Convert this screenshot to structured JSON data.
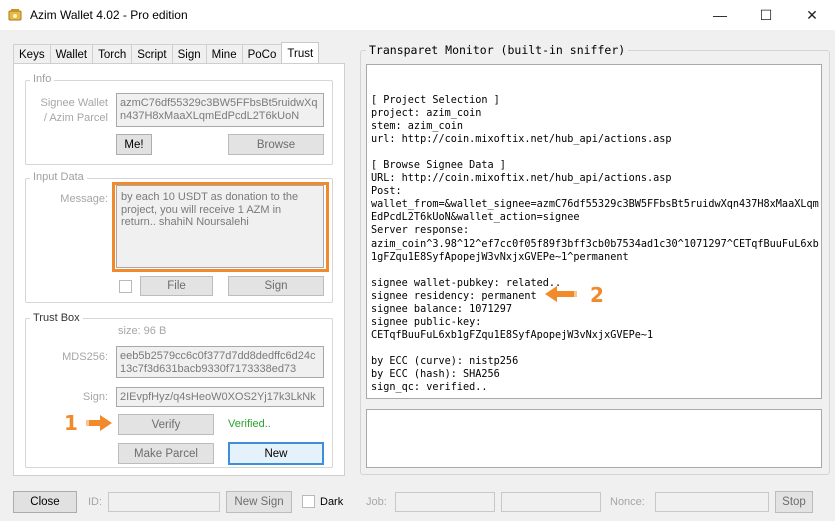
{
  "window": {
    "title": "Azim Wallet 4.02 - Pro edition",
    "controls": {
      "minimize": "—",
      "maximize": "☐",
      "close": "✕"
    }
  },
  "tabs": [
    "Keys",
    "Wallet",
    "Torch",
    "Script",
    "Sign",
    "Mine",
    "PoCo",
    "Trust"
  ],
  "active_tab": "Trust",
  "info": {
    "legend": "Info",
    "signee_label_1": "Signee Wallet",
    "signee_label_2": "/ Azim Parcel",
    "signee_value": "azmC76df55329c3BW5FFbsBt5ruidwXqn437H8xMaaXLqmEdPcdL2T6kUoN",
    "me_button": "Me!",
    "browse_button": "Browse"
  },
  "input_data": {
    "legend": "Input Data",
    "message_label": "Message:",
    "message_value": "by each 10 USDT as donation to the project, you will receive 1 AZM in return.. shahiN Noursalehi",
    "file_button": "File",
    "sign_button": "Sign"
  },
  "trust_box": {
    "legend": "Trust Box",
    "size": "size: 96 B",
    "mds_label": "MDS256:",
    "mds_value": "eeb5b2579cc6c0f377d7dd8dedffc6d24c13c7f3d631bacb9330f7173338ed73",
    "sign_label": "Sign:",
    "sign_value": "2IEvpfHyz/q4sHeoW0XOS2Yj17k3LkNk",
    "verify_button": "Verify",
    "verified_text": "Verified..",
    "make_parcel_button": "Make Parcel",
    "new_button": "New"
  },
  "bottom": {
    "close_button": "Close",
    "id_label": "ID:",
    "new_sign_button": "New Sign",
    "dark_label": "Dark",
    "job_label": "Job:",
    "nonce_label": "Nonce:",
    "stop_button": "Stop"
  },
  "monitor": {
    "title": "Transparet Monitor (built-in sniffer)",
    "log": "[ Project Selection ]\nproject: azim_coin\nstem: azim_coin\nurl: http://coin.mixoftix.net/hub_api/actions.asp\n\n[ Browse Signee Data ]\nURL: http://coin.mixoftix.net/hub_api/actions.asp\nPost:\nwallet_from=&wallet_signee=azmC76df55329c3BW5FFbsBt5ruidwXqn437H8xMaaXLqm\nEdPcdL2T6kUoN&wallet_action=signee\nServer response:\nazim_coin^3.98^12^ef7cc0f05f89f3bff3cb0b7534ad1c30^1071297^CETqfBuuFuL6xb\n1gFZqu1E8SyfApopejW3vNxjxGVEPe~1^permanent\n\nsignee wallet-pubkey: related..\nsignee residency: permanent\nsignee balance: 1071297\nsignee public-key:\nCETqfBuuFuL6xb1gFZqu1E8SyfApopejW3vNxjxGVEPe~1\n\nby ECC (curve): nistp256\nby ECC (hash): SHA256\nsign_qc: verified.."
  },
  "annotations": {
    "one": "1",
    "two": "2",
    "accent_color": "#f08a2b"
  },
  "colors": {
    "verified": "#2aa52a",
    "focus_border": "#3d8fd9"
  }
}
